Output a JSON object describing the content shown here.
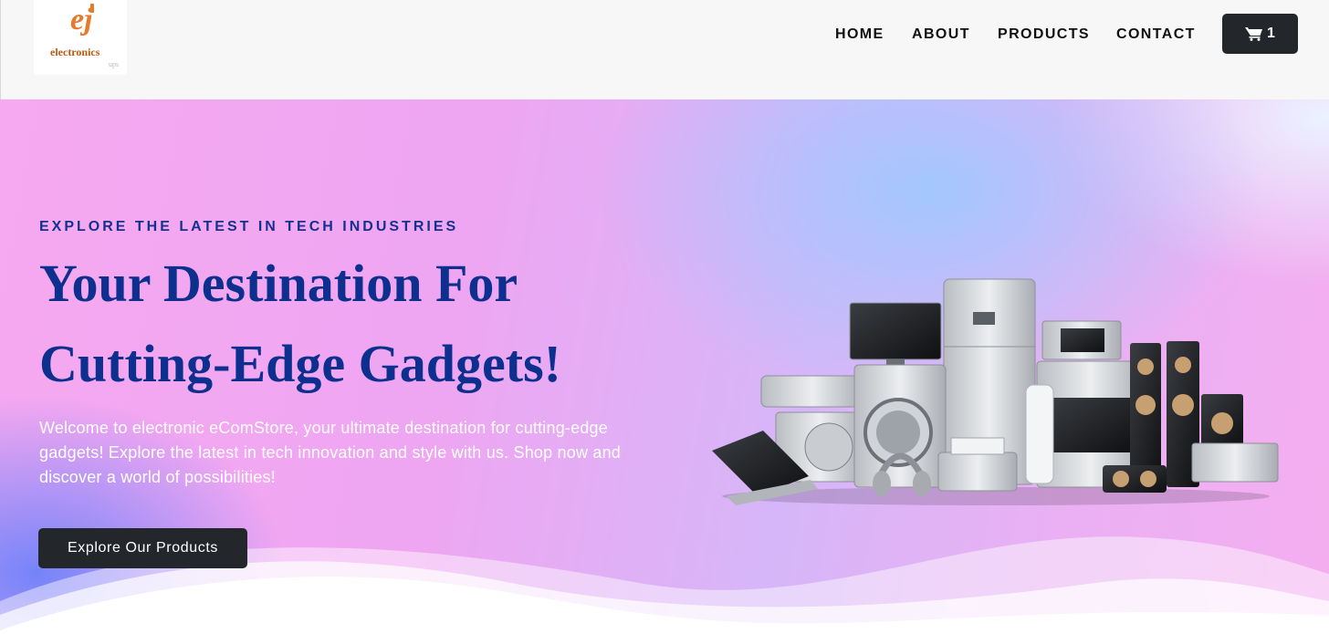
{
  "brand": {
    "logo_mark": "ej",
    "logo_text": "electronics",
    "logo_sub": "ups"
  },
  "nav": {
    "items": [
      {
        "label": "HOME"
      },
      {
        "label": "ABOUT"
      },
      {
        "label": "PRODUCTS"
      },
      {
        "label": "CONTACT"
      }
    ],
    "cart_count": "1"
  },
  "hero": {
    "eyebrow": "EXPLORE THE LATEST IN TECH INDUSTRIES",
    "headline_line1": "Your Destination For",
    "headline_line2": "Cutting-Edge Gadgets!",
    "description": "Welcome to electronic eComStore, your ultimate destination for cutting-edge gadgets! Explore the latest in tech innovation and style with us. Shop now and discover a world of possibilities!",
    "cta_label": "Explore Our Products"
  },
  "colors": {
    "header_bg": "#f7f7f7",
    "brand_orange": "#e8792a",
    "headline_blue": "#0d2f8e",
    "button_dark": "#23262b"
  },
  "icons": {
    "cart": "shopping-cart-icon",
    "logo": "plug-logo-icon"
  }
}
